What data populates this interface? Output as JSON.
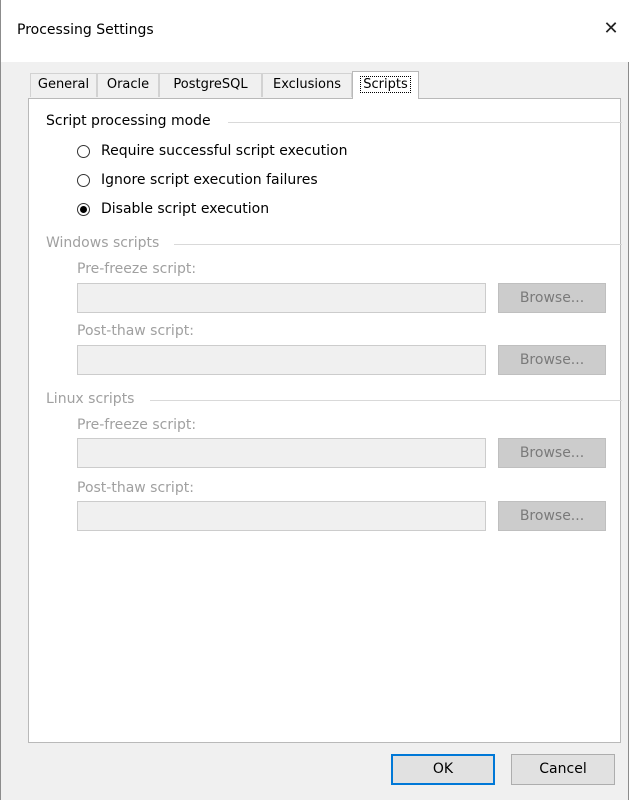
{
  "window": {
    "title": "Processing Settings",
    "close_glyph": "✕"
  },
  "tabs": [
    {
      "label": "General",
      "active": false
    },
    {
      "label": "Oracle",
      "active": false
    },
    {
      "label": "PostgreSQL",
      "active": false
    },
    {
      "label": "Exclusions",
      "active": false
    },
    {
      "label": "Scripts",
      "active": true
    }
  ],
  "script_mode": {
    "header": "Script processing mode",
    "options": [
      {
        "label": "Require successful script execution",
        "selected": false
      },
      {
        "label": "Ignore script execution failures",
        "selected": false
      },
      {
        "label": "Disable script execution",
        "selected": true
      }
    ]
  },
  "windows_scripts": {
    "header": "Windows scripts",
    "pre_freeze_label": "Pre-freeze script:",
    "pre_freeze_value": "",
    "post_thaw_label": "Post-thaw script:",
    "post_thaw_value": "",
    "browse_label": "Browse..."
  },
  "linux_scripts": {
    "header": "Linux scripts",
    "pre_freeze_label": "Pre-freeze script:",
    "pre_freeze_value": "",
    "post_thaw_label": "Post-thaw script:",
    "post_thaw_value": "",
    "browse_label": "Browse..."
  },
  "footer": {
    "ok_label": "OK",
    "cancel_label": "Cancel"
  }
}
